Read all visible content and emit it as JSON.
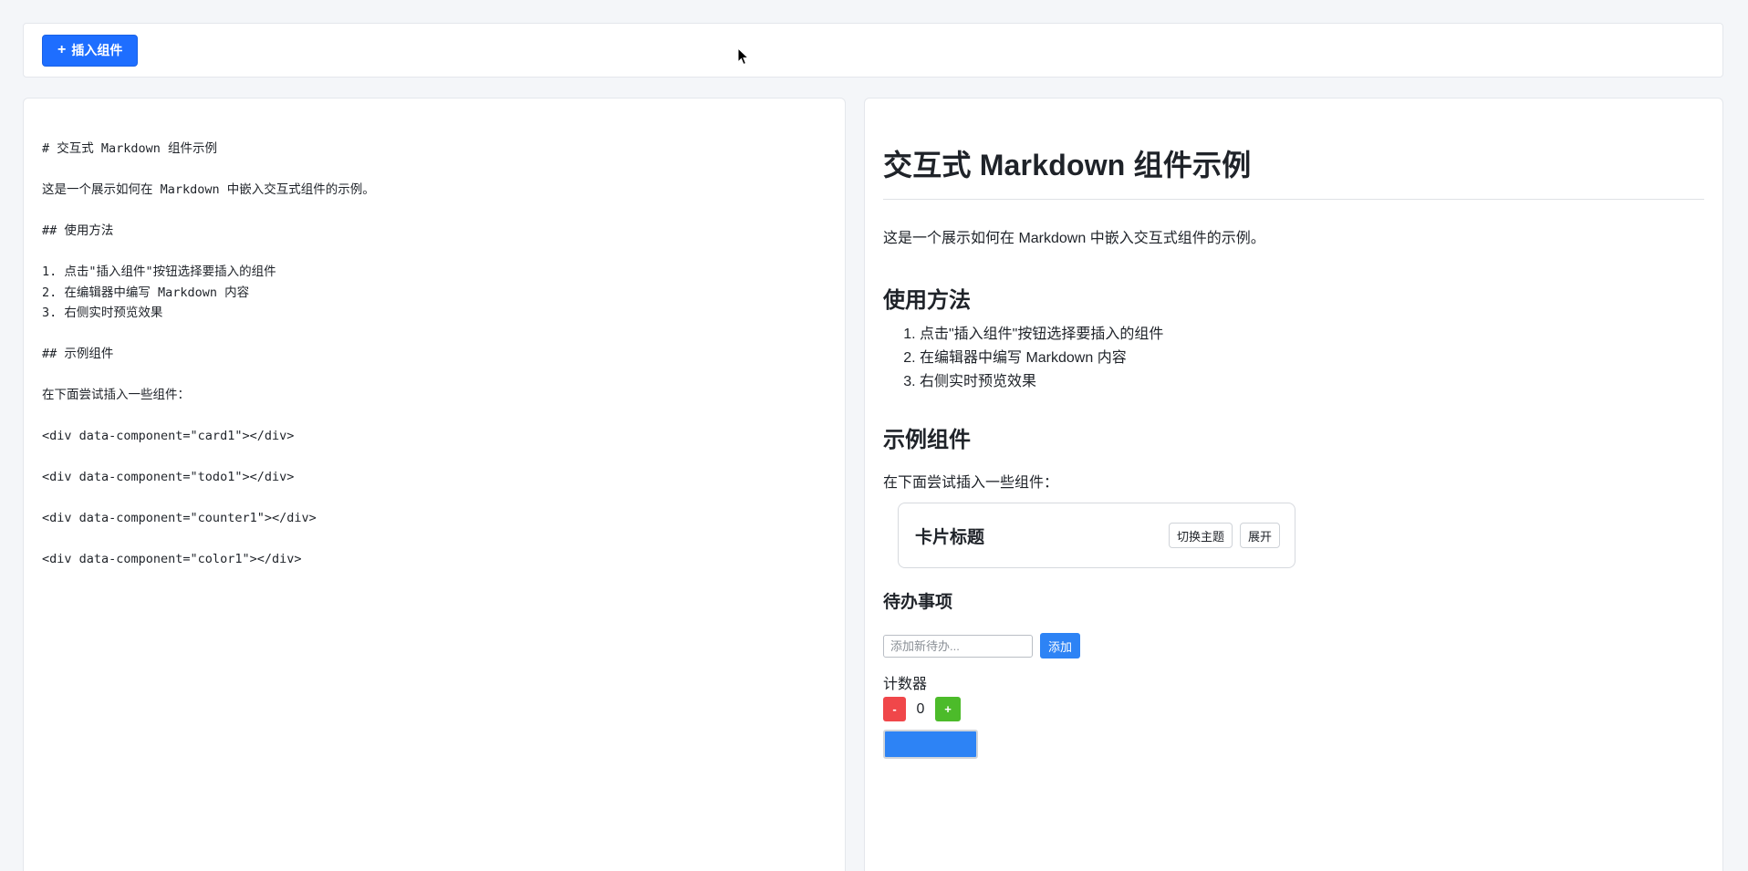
{
  "toolbar": {
    "insert_label": "插入组件",
    "insert_icon": "plus-icon"
  },
  "editor": {
    "lines": [
      "# 交互式 Markdown 组件示例",
      "",
      "这是一个展示如何在 Markdown 中嵌入交互式组件的示例。",
      "",
      "## 使用方法",
      "",
      "1. 点击\"插入组件\"按钮选择要插入的组件",
      "2. 在编辑器中编写 Markdown 内容",
      "3. 右侧实时预览效果",
      "",
      "## 示例组件",
      "",
      "在下面尝试插入一些组件：",
      "",
      "<div data-component=\"card1\"></div>",
      "",
      "<div data-component=\"todo1\"></div>",
      "",
      "<div data-component=\"counter1\"></div>",
      "",
      "<div data-component=\"color1\"></div>"
    ]
  },
  "preview": {
    "title": "交互式 Markdown 组件示例",
    "intro": "这是一个展示如何在 Markdown 中嵌入交互式组件的示例。",
    "usage_heading": "使用方法",
    "steps": [
      "点击\"插入组件\"按钮选择要插入的组件",
      "在编辑器中编写 Markdown 内容",
      "右侧实时预览效果"
    ],
    "examples_heading": "示例组件",
    "examples_intro": "在下面尝试插入一些组件：",
    "card": {
      "title": "卡片标题",
      "toggle_theme_label": "切换主题",
      "expand_label": "展开"
    },
    "todo": {
      "title": "待办事项",
      "input_value": "",
      "input_placeholder": "添加新待办...",
      "add_label": "添加"
    },
    "counter": {
      "label": "计数器",
      "minus_label": "-",
      "value": "0",
      "plus_label": "+"
    },
    "color": {
      "value": "#2d83f5"
    }
  },
  "colors": {
    "primary": "#1e6eff",
    "add_button": "#2d83f5",
    "minus_button": "#f0474a",
    "plus_button": "#4cbb2a"
  }
}
